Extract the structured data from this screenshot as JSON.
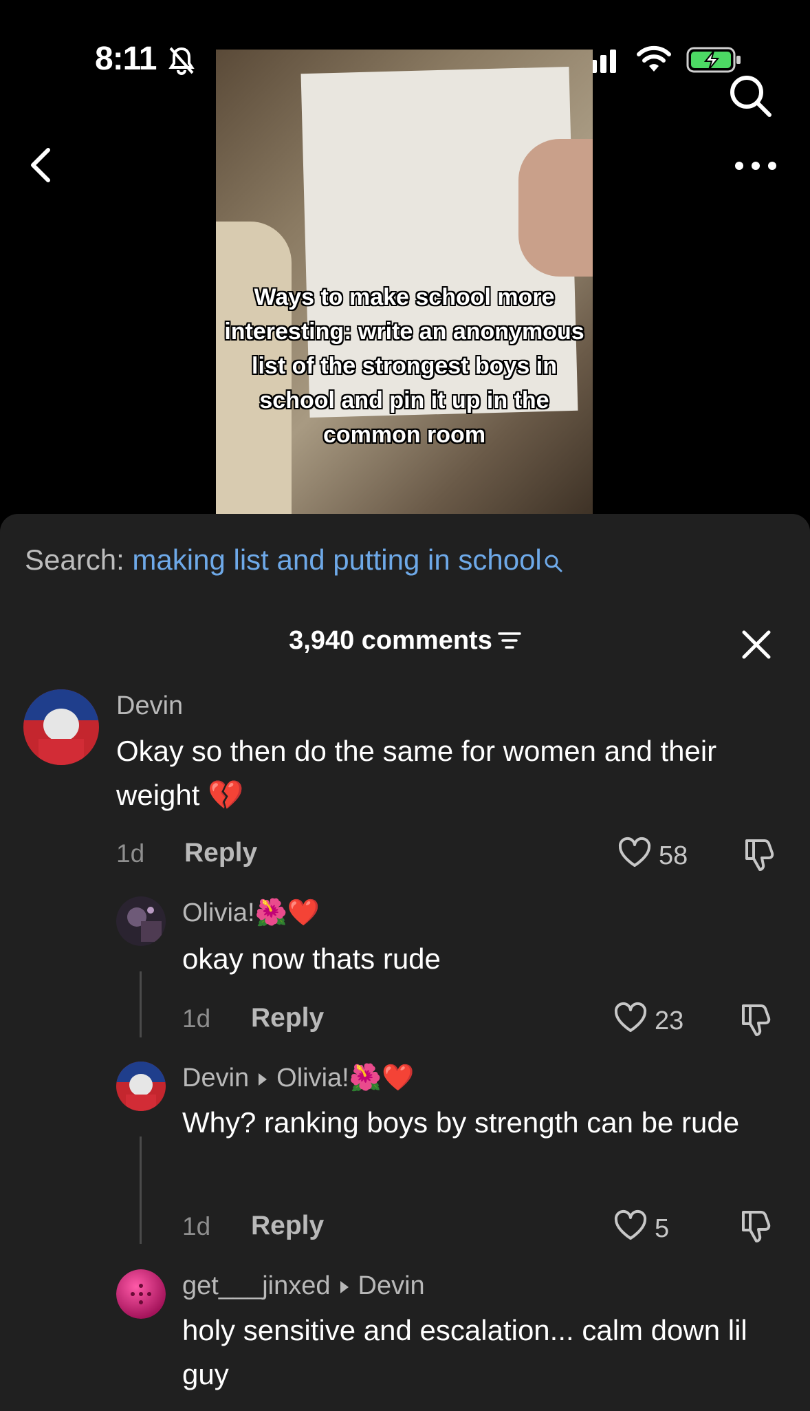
{
  "status_bar": {
    "time": "8:11",
    "icons": [
      "bell-slash-icon",
      "cellular-signal-icon",
      "wifi-icon",
      "battery-charging-icon"
    ]
  },
  "header": {
    "icons": [
      "back-chevron-icon",
      "search-icon",
      "more-icon"
    ]
  },
  "video": {
    "caption": "Ways to make school more interesting: write an anonymous list of the strongest boys in school and pin it up in the common room"
  },
  "search_suggestion": {
    "label": "Search:",
    "query": "making list and putting in school"
  },
  "comments_header": {
    "count_label": "3,940 comments"
  },
  "comments": [
    {
      "user": "Devin",
      "text": "Okay so then do the same for women and their weight 💔",
      "time": "1d",
      "reply_label": "Reply",
      "likes": "58"
    },
    {
      "user": "Olivia!🌺❤️",
      "text": "okay now thats rude",
      "time": "1d",
      "reply_label": "Reply",
      "likes": "23"
    },
    {
      "user": "Devin",
      "reply_to": "Olivia!🌺❤️",
      "text": "Why? ranking boys by strength can be rude",
      "time": "1d",
      "reply_label": "Reply",
      "likes": "5"
    },
    {
      "user": "get___jinxed",
      "reply_to": "Devin",
      "text": "holy sensitive and escalation... calm down lil guy"
    }
  ],
  "colors": {
    "panel_bg": "#202020",
    "search_query": "#6ea9e8",
    "muted_text": "#8f8f8f"
  }
}
